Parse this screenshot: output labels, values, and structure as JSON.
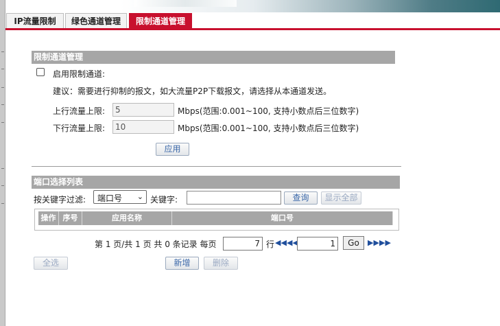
{
  "tabs": [
    {
      "label": "IP流量限制",
      "active": false
    },
    {
      "label": "绿色通道管理",
      "active": false
    },
    {
      "label": "限制通道管理",
      "active": true
    }
  ],
  "limit_section": {
    "title": "限制通道管理",
    "enable_label": "启用限制通道:",
    "enable_checked": false,
    "advice": "建议：需要进行抑制的报文，如大流量P2P下载报文，请选择从本通道发送。",
    "upstream_label": "上行流量上限:",
    "upstream_value": "5",
    "upstream_hint": "Mbps(范围:0.001~100, 支持小数点后三位数字)",
    "downstream_label": "下行流量上限:",
    "downstream_value": "10",
    "downstream_hint": "Mbps(范围:0.001~100, 支持小数点后三位数字)",
    "apply_button": "应用"
  },
  "port_section": {
    "title": "端口选择列表",
    "filter_label": "按关键字过滤:",
    "filter_selected": "端口号",
    "keyword_label": "关键字:",
    "keyword_value": "",
    "search_button": "查询",
    "show_all_button": "显示全部",
    "columns": [
      "操作",
      "序号",
      "应用名称",
      "端口号"
    ],
    "rows": []
  },
  "pagination": {
    "text": "第 1 页/共 1 页 共 0 条记录 每页",
    "per_page": "7",
    "rows_unit": "行",
    "current_page": "1",
    "go_button": "Go"
  },
  "actions": {
    "select_all": "全选",
    "add": "新增",
    "delete": "删除"
  },
  "colors": {
    "accent_red": "#c8102e",
    "section_gray": "#a6a6a6",
    "link_blue": "#3a67a8"
  },
  "icons": [
    "first-page-icon",
    "prev-page-icon",
    "next-page-icon",
    "last-page-icon",
    "select-dropdown-icon"
  ]
}
